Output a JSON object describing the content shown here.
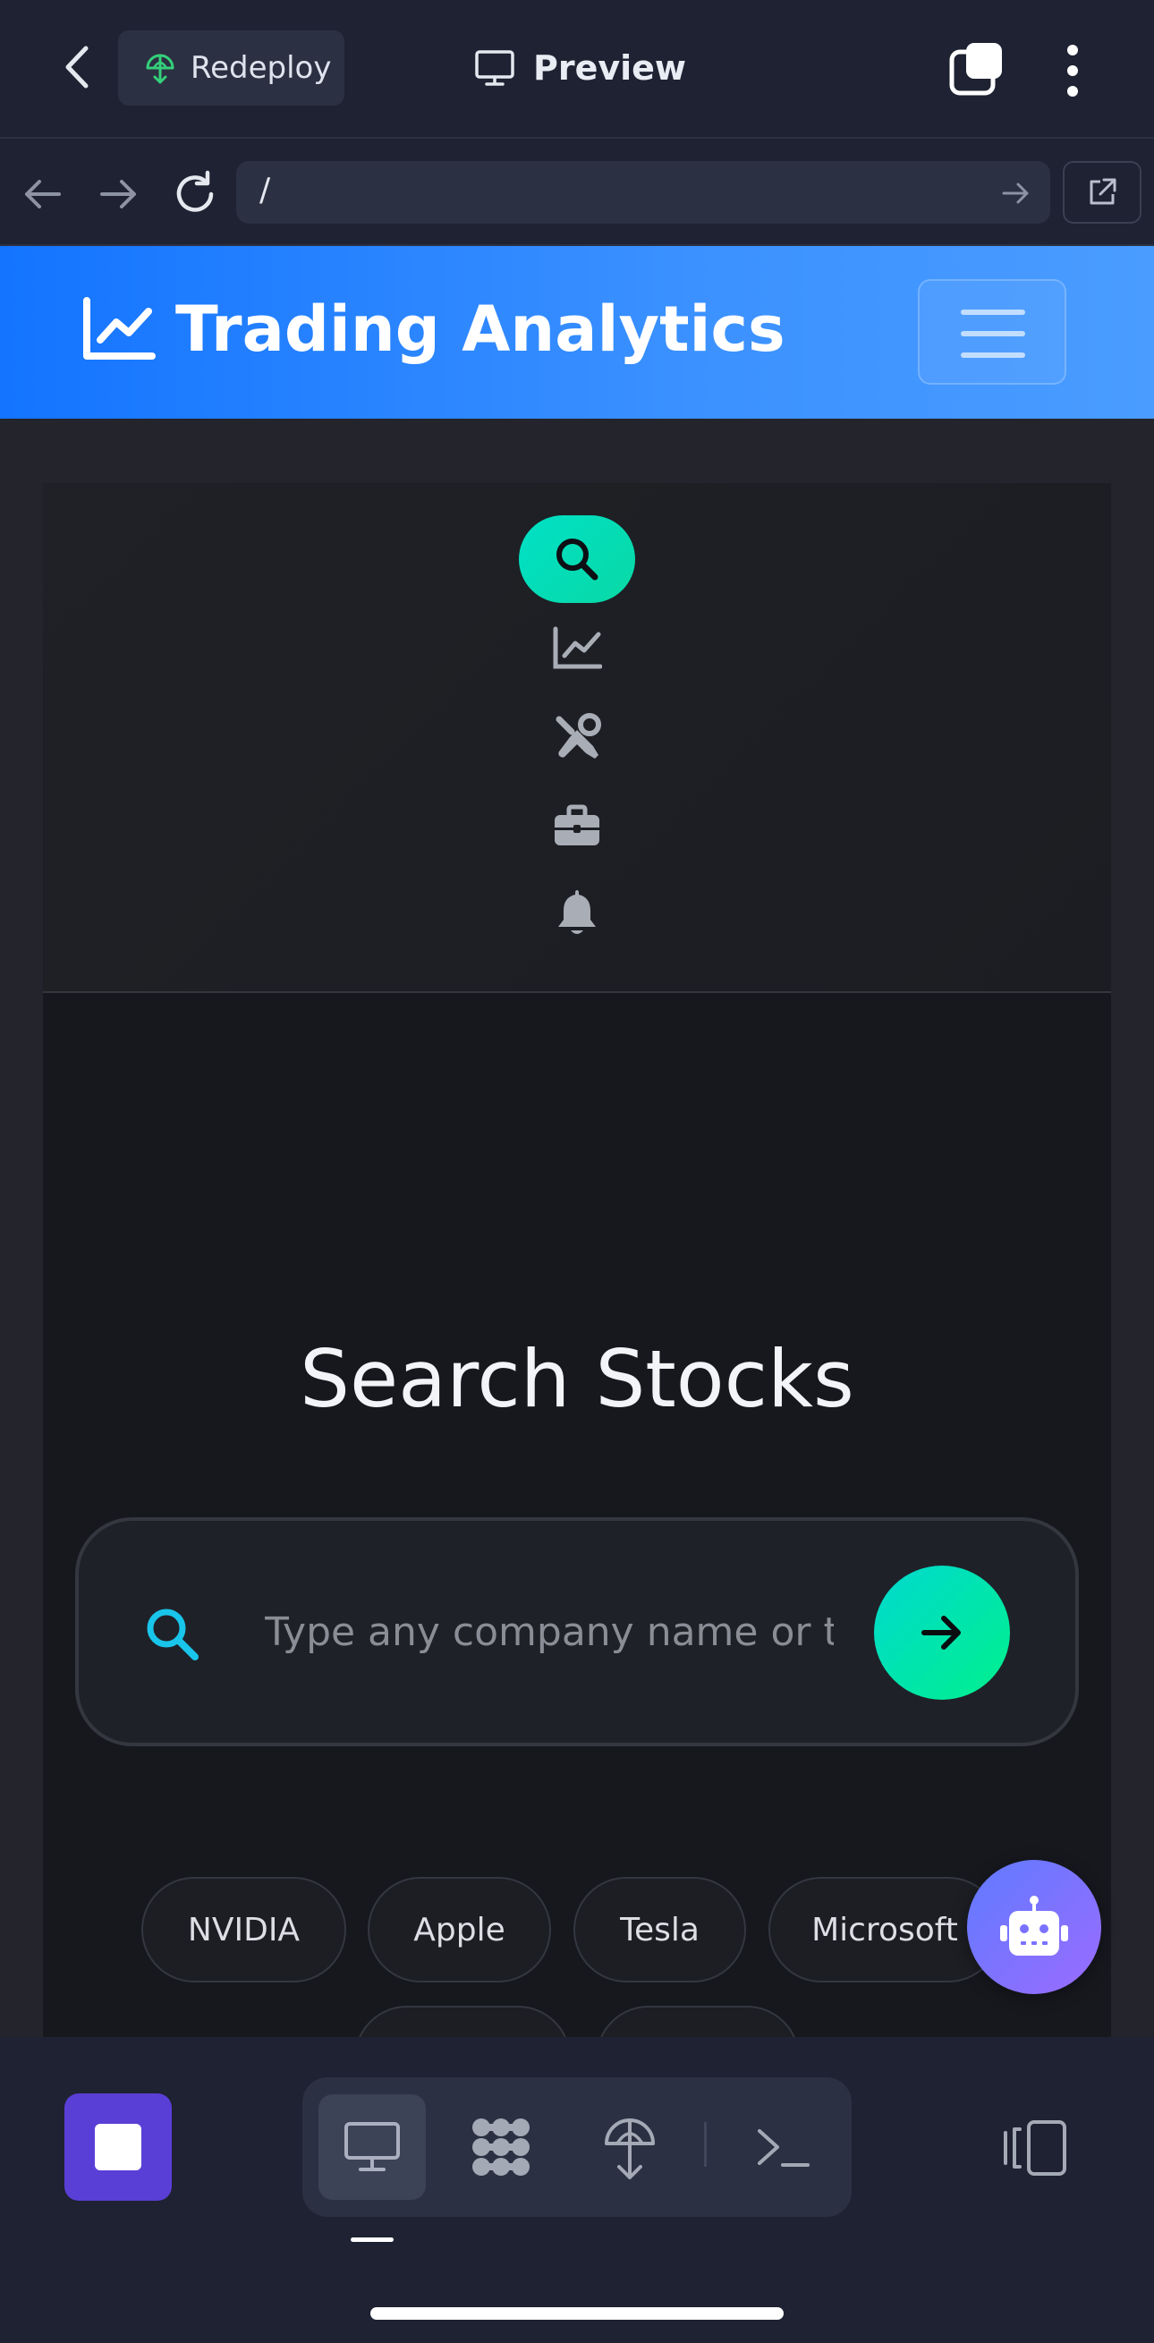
{
  "app_bar": {
    "redeploy_label": "Redeploy",
    "title": "Preview"
  },
  "browser": {
    "url": "/"
  },
  "site": {
    "title": "Trading Analytics",
    "heading": "Search Stocks",
    "search_placeholder": "Type any company name or ticker",
    "chips": [
      "NVIDIA",
      "Apple",
      "Tesla",
      "Microsoft"
    ],
    "colors": {
      "header_gradient_start": "#1374ff",
      "accent": "#00e0c6",
      "bot_button": "#7a72ff"
    }
  },
  "dock": {
    "icons": [
      "search-icon",
      "chart-line-icon",
      "tools-icon",
      "briefcase-icon",
      "bell-icon"
    ],
    "active": "search-icon"
  },
  "bottom_bar": {
    "modes": [
      "preview-icon",
      "integrations-icon",
      "deploy-icon",
      "terminal-icon"
    ],
    "active_mode": "preview-icon",
    "stop_color": "#5a3fd6"
  }
}
